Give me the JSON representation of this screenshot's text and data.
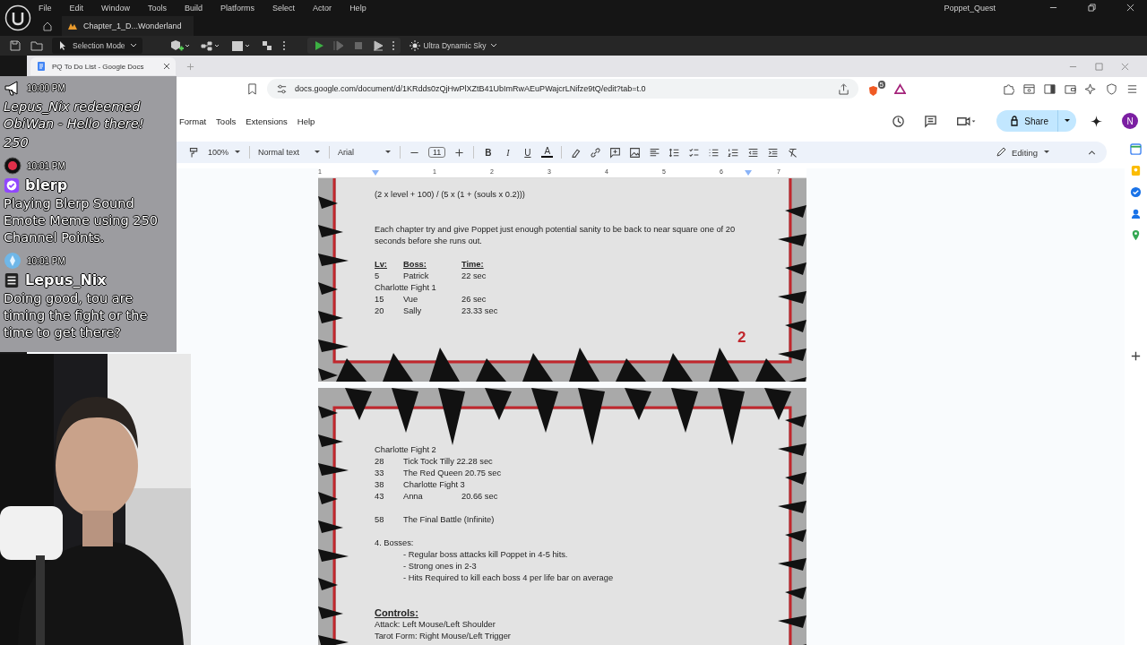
{
  "editor": {
    "menu": [
      "File",
      "Edit",
      "Window",
      "Tools",
      "Build",
      "Platforms",
      "Select",
      "Actor",
      "Help"
    ],
    "level_tab": "Chapter_1_D...Wonderland",
    "project": "Poppet_Quest",
    "mode": "Selection Mode",
    "sky": "Ultra Dynamic Sky"
  },
  "browser": {
    "tab_title": "PQ To Do List - Google Docs",
    "url": "docs.google.com/document/d/1KRdds0zQjHwPlXZtB41UbImRwAEuPWajcrLNifze9tQ/edit?tab=t.0",
    "shield_badge": "5"
  },
  "docs": {
    "menus": [
      "Format",
      "Tools",
      "Extensions",
      "Help"
    ],
    "share": "Share",
    "avatar": "N",
    "zoom": "100%",
    "style": "Normal text",
    "font": "Arial",
    "font_size": "11",
    "format_buttons": [
      "B",
      "I",
      "U",
      "A"
    ],
    "mode": "Editing",
    "ruler": [
      "1",
      "1",
      "2",
      "3",
      "4",
      "5",
      "6",
      "7"
    ]
  },
  "pages": [
    {
      "page_number": "2",
      "lines": [
        {
          "kind": "text",
          "text": "(2 x level + 100) / (5 x (1 + (souls x 0.2)))"
        },
        {
          "kind": "text",
          "double_gap_before": true,
          "text": "Each chapter try and give Poppet just enough potential sanity to be back to near square one of 20 seconds before she runs out."
        },
        {
          "kind": "header_row",
          "gap_before": true,
          "cells": [
            "Lv:",
            "Boss:",
            "Time:"
          ]
        },
        {
          "kind": "row",
          "cells": [
            "5",
            "Patrick",
            "22 sec"
          ]
        },
        {
          "kind": "text",
          "text": "Charlotte Fight 1"
        },
        {
          "kind": "row",
          "cells": [
            "15",
            "Vue",
            "26 sec"
          ]
        },
        {
          "kind": "row",
          "cells": [
            "20",
            "Sally",
            "23.33 sec"
          ]
        }
      ]
    },
    {
      "lines": [
        {
          "kind": "text",
          "text": "Charlotte Fight 2"
        },
        {
          "kind": "row",
          "cells": [
            "28",
            "Tick Tock Tilly 22.28 sec"
          ]
        },
        {
          "kind": "row",
          "cells": [
            "33",
            "The Red Queen 20.75 sec"
          ]
        },
        {
          "kind": "row",
          "cells": [
            "38",
            "Charlotte Fight 3"
          ]
        },
        {
          "kind": "row",
          "cells": [
            "43",
            "Anna",
            "20.66 sec"
          ]
        },
        {
          "kind": "row",
          "gap_before": true,
          "cells": [
            "58",
            "The Final Battle (Infinite)"
          ]
        },
        {
          "kind": "text",
          "gap_before": true,
          "text": "4. Bosses:"
        },
        {
          "kind": "indent",
          "text": "- Regular boss attacks kill Poppet in 4-5 hits."
        },
        {
          "kind": "indent",
          "text": "- Strong ones in 2-3"
        },
        {
          "kind": "indent",
          "text": "- Hits Required to kill each boss 4 per life bar on average"
        },
        {
          "kind": "heading",
          "double_gap_before": true,
          "text": "Controls:"
        },
        {
          "kind": "text",
          "text": "Attack: Left Mouse/Left Shoulder"
        },
        {
          "kind": "text",
          "text": "Tarot Form: Right Mouse/Left Trigger"
        }
      ]
    }
  ],
  "chat": [
    {
      "kind": "redemption",
      "time": "10:00 PM",
      "text": "Lepus_Nix redeemed ObiWan - Hello there!",
      "cost": "250"
    },
    {
      "kind": "bot",
      "time": "10:01 PM",
      "user": "blerp",
      "text": "Playing Blerp Sound Emote Meme using 250 Channel Points."
    },
    {
      "kind": "viewer",
      "time": "10:01 PM",
      "user": "Lepus_Nix",
      "text": "Doing good, tou are timing the fight or the time to get there?"
    }
  ]
}
